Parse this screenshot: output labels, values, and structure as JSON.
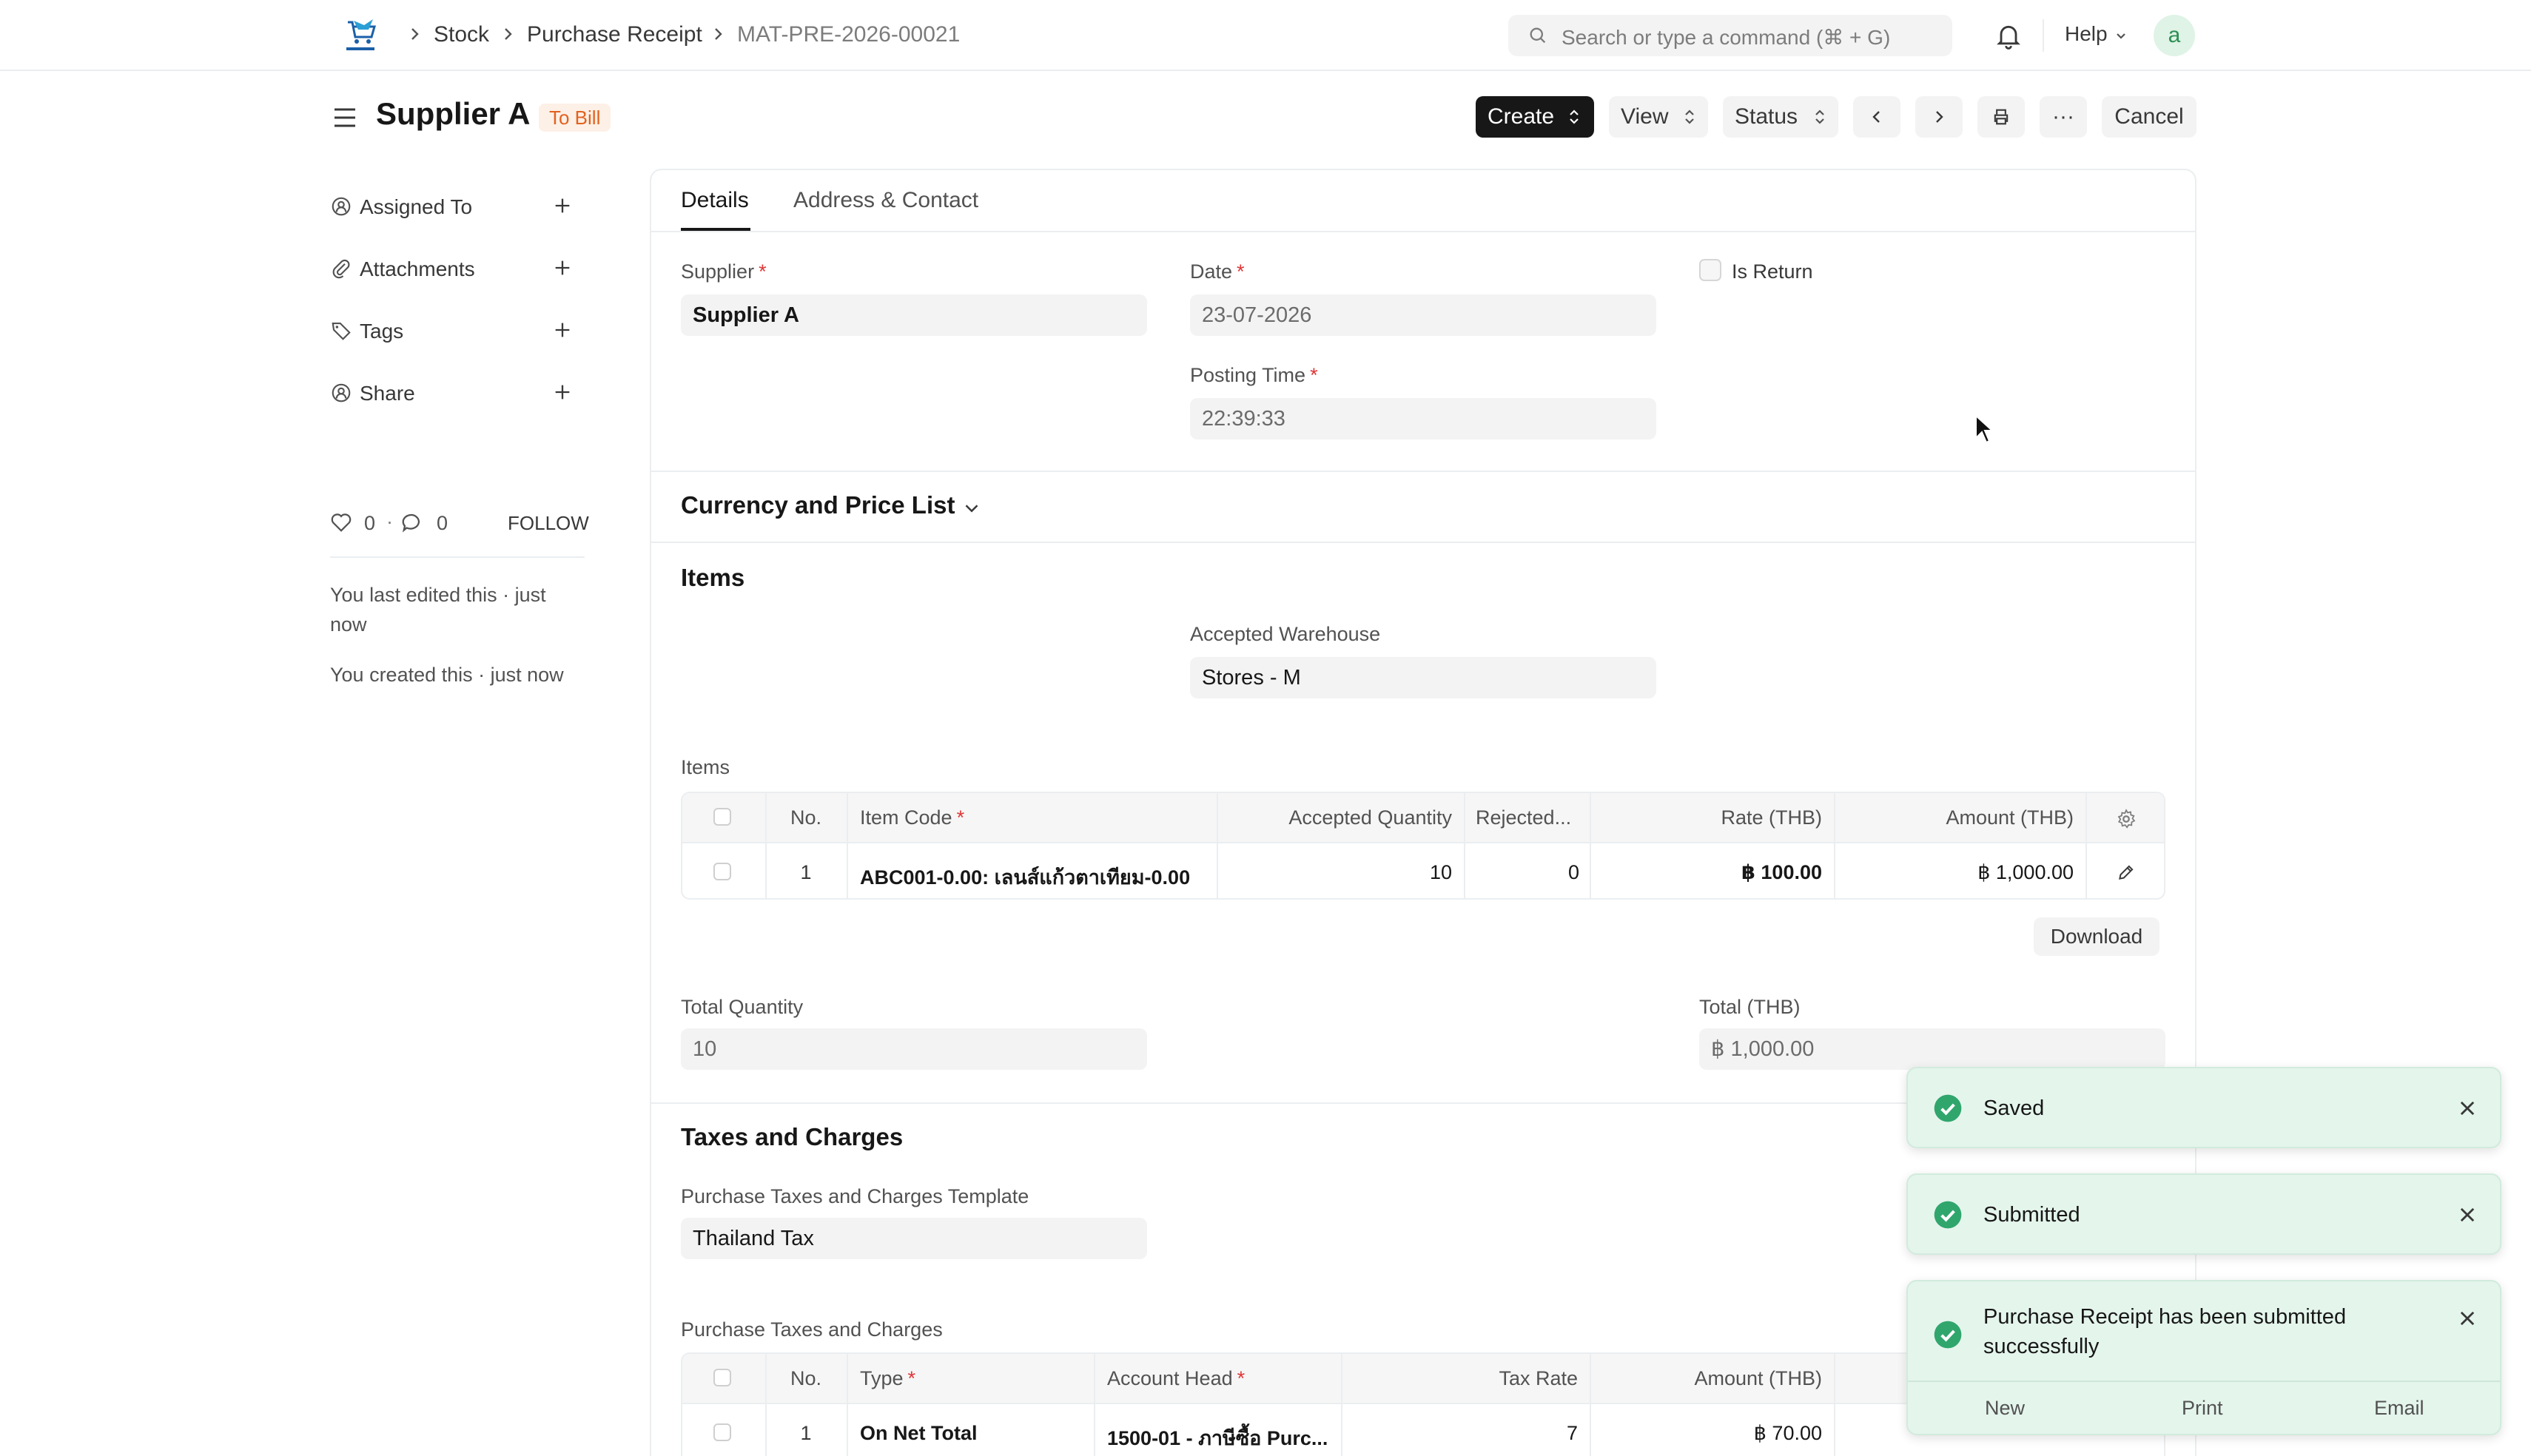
{
  "navbar": {
    "breadcrumbs": [
      "Stock",
      "Purchase Receipt",
      "MAT-PRE-2026-00021"
    ],
    "search_placeholder": "Search or type a command (⌘ + G)",
    "help_label": "Help",
    "avatar_letter": "a"
  },
  "header": {
    "title": "Supplier A",
    "status": "To Bill",
    "buttons": {
      "create": "Create",
      "view": "View",
      "status": "Status",
      "more": "···",
      "cancel": "Cancel"
    }
  },
  "sidebar": {
    "items": [
      {
        "label": "Assigned To",
        "icon": "assign-icon"
      },
      {
        "label": "Attachments",
        "icon": "paperclip-icon"
      },
      {
        "label": "Tags",
        "icon": "tag-icon"
      },
      {
        "label": "Share",
        "icon": "share-icon"
      }
    ],
    "likes": "0",
    "comments": "0",
    "follow_label": "FOLLOW",
    "edit_note_1": "You last edited this · just",
    "edit_note_2": "now",
    "created_note": "You created this · just now"
  },
  "tabs": [
    "Details",
    "Address & Contact"
  ],
  "details": {
    "supplier_label": "Supplier",
    "supplier_value": "Supplier A",
    "date_label": "Date",
    "date_value": "23-07-2026",
    "posting_time_label": "Posting Time",
    "posting_time_value": "22:39:33",
    "is_return_label": "Is Return"
  },
  "currency_section": {
    "title": "Currency and Price List"
  },
  "items_section": {
    "title": "Items",
    "warehouse_label": "Accepted Warehouse",
    "warehouse_value": "Stores - M",
    "table_label": "Items",
    "columns": [
      "No.",
      "Item Code",
      "Accepted Quantity",
      "Rejected...",
      "Rate (THB)",
      "Amount (THB)"
    ],
    "rows": [
      {
        "no": "1",
        "item_code": "ABC001-0.00: เลนส์แก้วตาเทียม-0.00",
        "accepted_qty": "10",
        "rejected": "0",
        "rate": "฿ 100.00",
        "amount": "฿ 1,000.00"
      }
    ],
    "download_label": "Download",
    "total_qty_label": "Total Quantity",
    "total_qty_value": "10",
    "total_label": "Total (THB)",
    "total_value": "฿ 1,000.00"
  },
  "taxes_section": {
    "title": "Taxes and Charges",
    "template_label": "Purchase Taxes and Charges Template",
    "template_value": "Thailand Tax",
    "table_label": "Purchase Taxes and Charges",
    "columns": [
      "No.",
      "Type",
      "Account Head",
      "Tax Rate",
      "Amount (THB)"
    ],
    "rows": [
      {
        "no": "1",
        "type": "On Net Total",
        "account_head": "1500-01 - ภาษีซื้อ Purc...",
        "tax_rate": "7",
        "amount": "฿ 70.00"
      }
    ]
  },
  "toasts": [
    {
      "text": "Saved"
    },
    {
      "text": "Submitted"
    },
    {
      "text_line1": "Purchase Receipt has been submitted",
      "text_line2": "successfully",
      "actions": [
        "New",
        "Print",
        "Email"
      ]
    }
  ],
  "colors": {
    "primary_dark": "#171717",
    "status_orange": "#e2621f",
    "toast_green": "#e4f5ec",
    "check_green": "#30a66d",
    "required_red": "#e03636"
  }
}
